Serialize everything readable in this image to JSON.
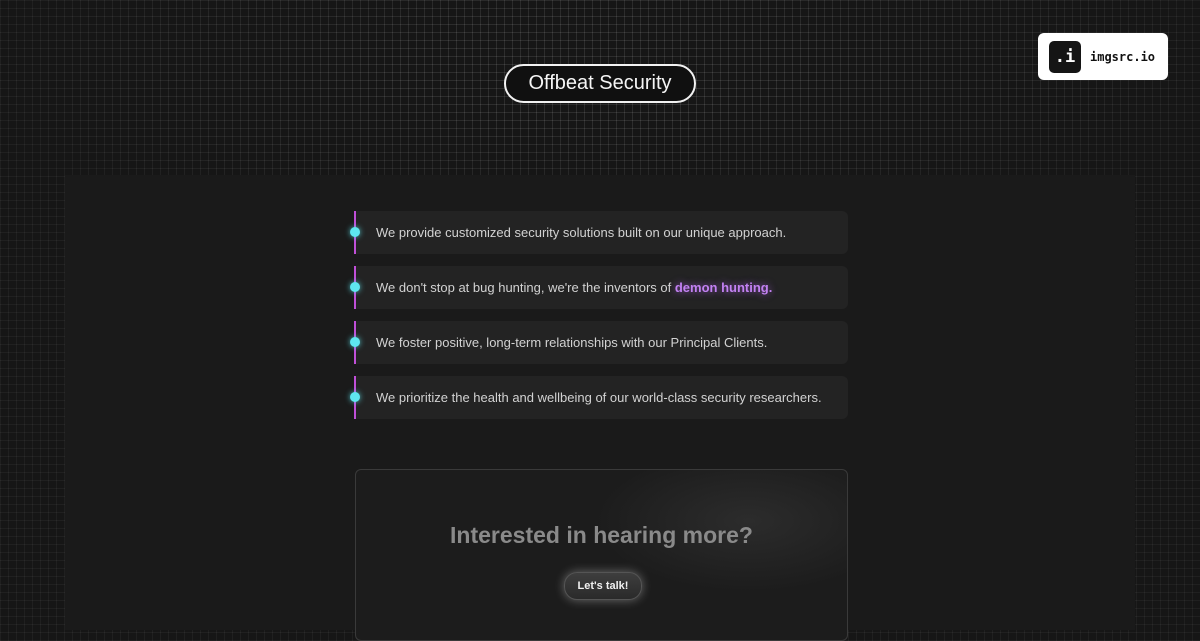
{
  "header": {
    "brand_title": "Offbeat Security"
  },
  "watermark": {
    "icon_glyph": ".i",
    "label": "imgsrc.io"
  },
  "features": [
    {
      "text": "We provide customized security solutions built on our unique approach.",
      "highlight": ""
    },
    {
      "text": "We don't stop at bug hunting, we're the inventors of ",
      "highlight": "demon hunting."
    },
    {
      "text": "We foster positive, long-term relationships with our Principal Clients.",
      "highlight": ""
    },
    {
      "text": "We prioritize the health and wellbeing of our world-class security researchers.",
      "highlight": ""
    }
  ],
  "cta": {
    "heading": "Interested in hearing more?",
    "button_label": "Let's talk!"
  },
  "colors": {
    "background": "#161616",
    "accent_line": "#c04fd8",
    "accent_dot": "#5ee6f0",
    "highlight_text": "#c281f2"
  }
}
